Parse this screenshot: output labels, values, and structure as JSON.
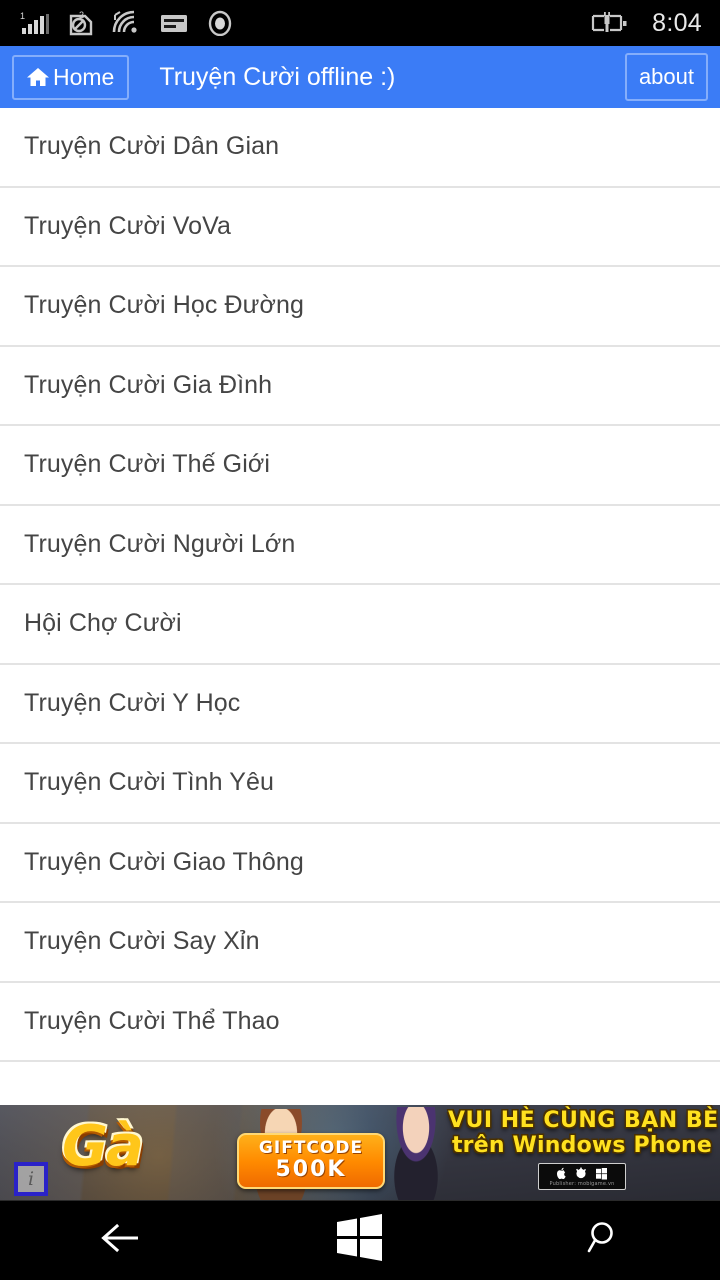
{
  "status_bar": {
    "icons": [
      {
        "name": "signal-strength-icon",
        "label": "1"
      },
      {
        "name": "sim2-roaming-icon",
        "label": "2"
      },
      {
        "name": "wifi-icon",
        "label": ""
      },
      {
        "name": "sim-card-icon",
        "label": ""
      },
      {
        "name": "bluetooth-circle-icon",
        "label": ""
      }
    ],
    "battery_icon": "battery-charging-icon",
    "clock": "8:04"
  },
  "header": {
    "home_label": "Home",
    "home_icon": "home-icon",
    "title": "Truyện Cười offline :)",
    "about_label": "about",
    "accent_color": "#3b7cf6",
    "border_color": "#85aefb"
  },
  "list": {
    "items": [
      {
        "label": "Truyện Cười Dân Gian"
      },
      {
        "label": "Truyện Cười VoVa"
      },
      {
        "label": "Truyện Cười Học Đường"
      },
      {
        "label": "Truyện Cười Gia Đình"
      },
      {
        "label": "Truyện Cười Thế Giới"
      },
      {
        "label": "Truyện Cười Người Lớn"
      },
      {
        "label": "Hội Chợ Cười"
      },
      {
        "label": "Truyện Cười Y Học"
      },
      {
        "label": "Truyện Cười Tình Yêu"
      },
      {
        "label": "Truyện Cười Giao Thông"
      },
      {
        "label": "Truyện Cười Say Xỉn"
      },
      {
        "label": "Truyện Cười Thể Thao"
      }
    ],
    "text_color": "#454545",
    "divider_color": "#e3e3e3"
  },
  "ad": {
    "logo_text": "Gà",
    "giftcode_line1": "GIFTCODE",
    "giftcode_line2": "500K",
    "slogan_line1": "VUI HÈ CÙNG BẠN BÈ",
    "slogan_line2": "trên Windows Phone",
    "publisher_text": "Publisher: mobigame.vn",
    "info_badge": "i",
    "platform_icons": [
      "apple-icon",
      "android-icon",
      "windows-icon"
    ]
  },
  "nav_bar": {
    "buttons": [
      {
        "name": "back-button",
        "icon": "back-arrow-icon"
      },
      {
        "name": "start-button",
        "icon": "windows-logo-icon"
      },
      {
        "name": "search-button",
        "icon": "search-icon"
      }
    ]
  }
}
